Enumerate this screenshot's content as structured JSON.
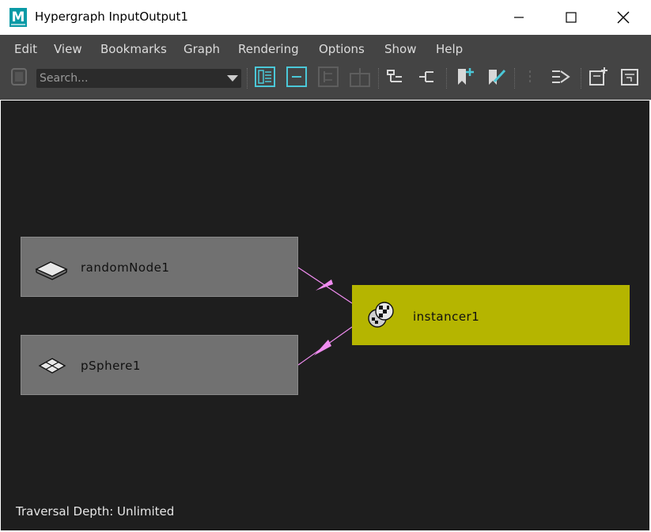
{
  "window": {
    "title": "Hypergraph InputOutput1"
  },
  "menu": {
    "items": [
      "Edit",
      "View",
      "Bookmarks",
      "Graph",
      "Rendering",
      "Options",
      "Show",
      "Help"
    ]
  },
  "toolbar": {
    "search_placeholder": "Search..."
  },
  "graph": {
    "nodes": [
      {
        "label": "randomNode1",
        "icon": "layer-sheets-icon",
        "color": "#717171"
      },
      {
        "label": "pSphere1",
        "icon": "transform-diamond-icon",
        "color": "#717171"
      },
      {
        "label": "instancer1",
        "icon": "instancer-icon",
        "color": "#b5b500"
      }
    ],
    "connection_color": "#f08cf0",
    "status": "Traversal Depth: Unlimited"
  }
}
